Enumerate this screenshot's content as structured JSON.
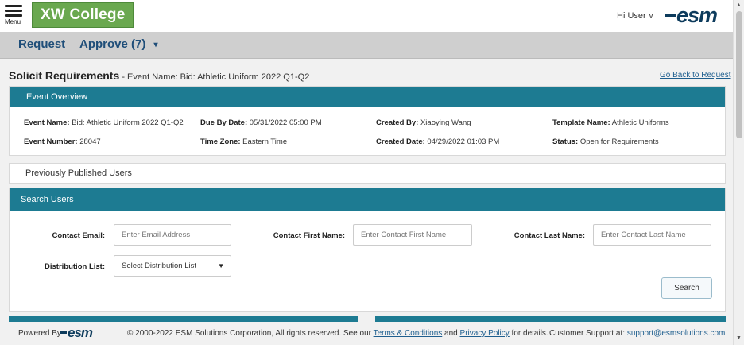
{
  "header": {
    "menu_label": "Menu",
    "logo_text": "XW College",
    "greeting": "Hi User",
    "greeting_caret": "∨",
    "brand": "esm"
  },
  "nav": {
    "request": "Request",
    "approve": "Approve (7)",
    "approve_caret": "▾"
  },
  "page": {
    "title": "Solicit Requirements",
    "subtitle": " - Event Name: Bid: Athletic Uniform 2022 Q1-Q2",
    "back_link": "Go Back to Request"
  },
  "event_overview": {
    "heading": "Event Overview",
    "items": [
      {
        "label": "Event Name:",
        "value": " Bid: Athletic Uniform 2022 Q1-Q2"
      },
      {
        "label": "Due By Date:",
        "value": " 05/31/2022 05:00 PM"
      },
      {
        "label": "Created By:",
        "value": " Xiaoying Wang"
      },
      {
        "label": "Template Name:",
        "value": " Athletic Uniforms"
      },
      {
        "label": "Event Number:",
        "value": " 28047"
      },
      {
        "label": "Time Zone:",
        "value": " Eastern Time"
      },
      {
        "label": "Created Date:",
        "value": " 04/29/2022 01:03 PM"
      },
      {
        "label": "Status:",
        "value": " Open for Requirements"
      }
    ]
  },
  "published_users": {
    "label": "Previously Published Users"
  },
  "search_users": {
    "heading": "Search Users",
    "contact_email": {
      "label": "Contact Email:",
      "placeholder": "Enter Email Address"
    },
    "contact_first_name": {
      "label": "Contact First Name:",
      "placeholder": "Enter Contact First Name"
    },
    "contact_last_name": {
      "label": "Contact Last Name:",
      "placeholder": "Enter Contact Last Name"
    },
    "distribution_list": {
      "label": "Distribution List:",
      "selected": "Select Distribution List",
      "arrow": "▼"
    },
    "search_button": "Search"
  },
  "footer": {
    "powered_by": "Powered By:",
    "brand": "esm",
    "copyright_prefix": "© 2000-2022 ESM Solutions Corporation, All rights reserved. See our ",
    "terms_link": "Terms & Conditions",
    "and_text": " and ",
    "privacy_link": "Privacy Policy",
    "copyright_suffix": " for details.",
    "support_prefix": "Customer Support at: ",
    "support_email": "support@esmsolutions.com"
  },
  "scrollbar": {
    "up_arrow": "▲",
    "down_arrow": "▼"
  },
  "colors": {
    "accent_teal": "#1d7b92",
    "logo_green": "#6aa84f",
    "nav_text": "#1f4e79",
    "brand_navy": "#0d3b5c"
  }
}
